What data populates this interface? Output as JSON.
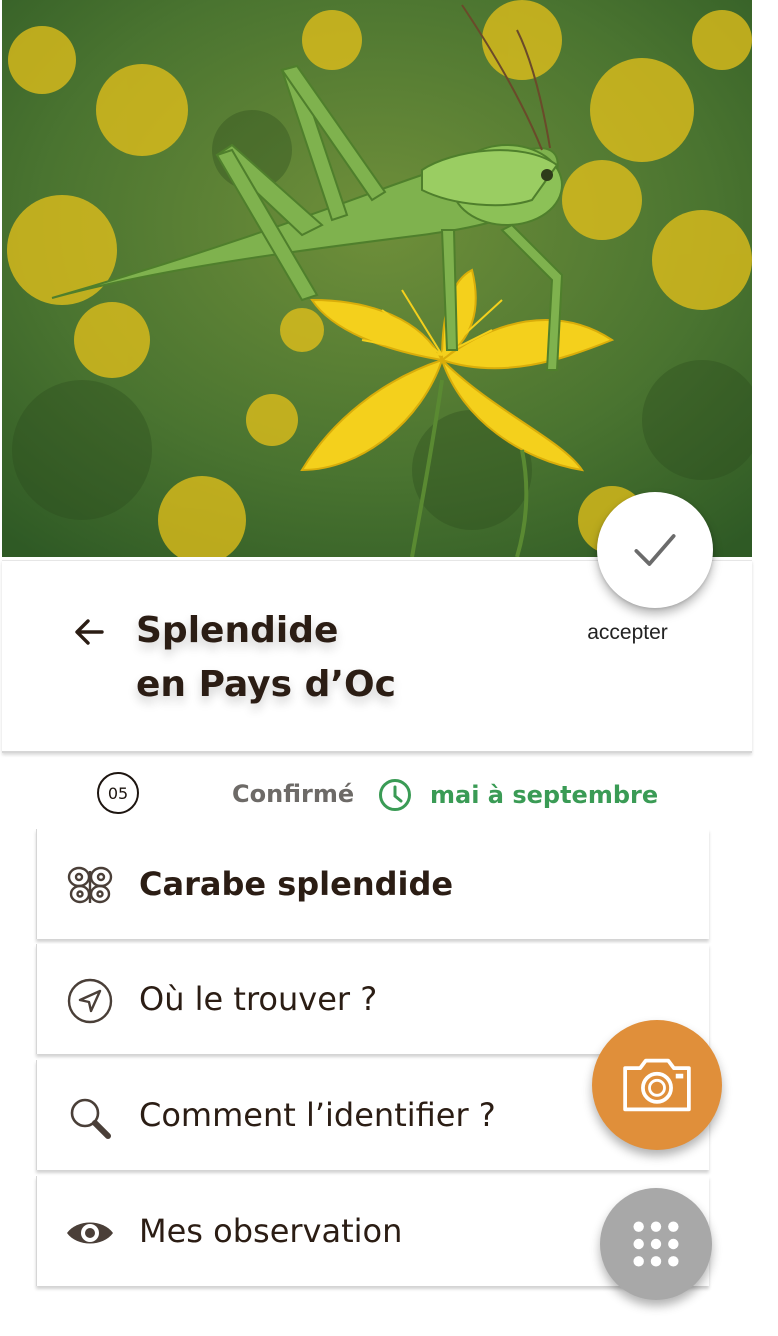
{
  "hero": {
    "photo_icon": "grasshopper-on-yellow-flowers-photo"
  },
  "header": {
    "title_line1": "Splendide",
    "title_line2": "en Pays d’Oc",
    "back_icon": "arrow-left-icon",
    "accept_label": "accepter",
    "accept_icon": "checkmark-icon"
  },
  "meta": {
    "number": "05",
    "status": "Confirmé",
    "period": "mai à septembre",
    "period_icon": "clock-icon",
    "period_color": "#3a9b55"
  },
  "menu": {
    "items": [
      {
        "label": "Carabe splendide",
        "icon": "butterfly-icon"
      },
      {
        "label": "Où le trouver ?",
        "icon": "navigation-arrow-icon"
      },
      {
        "label": "Comment l’identifier ?",
        "icon": "magnifier-icon"
      },
      {
        "label": "Mes observation",
        "icon": "eye-icon"
      }
    ]
  },
  "fabs": {
    "camera_icon": "camera-icon",
    "camera_color": "#e08f3a",
    "grid_icon": "grid-menu-icon",
    "grid_color": "#a8a8a8"
  }
}
